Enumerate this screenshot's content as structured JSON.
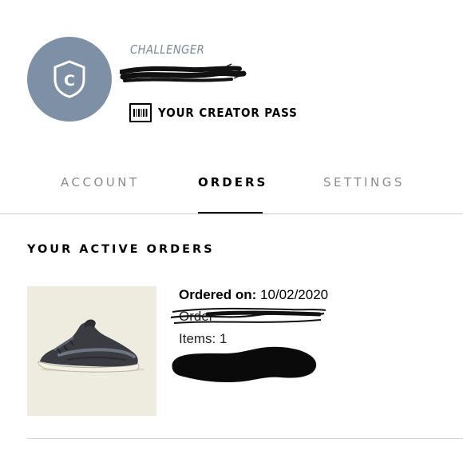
{
  "profile": {
    "avatar_initial": "C",
    "tier_label": "CHALLENGER",
    "creator_pass_label": "YOUR CREATOR PASS",
    "avatar_color": "#7d90a6",
    "tier_color": "#7a8796"
  },
  "tabs": [
    {
      "label": "ACCOUNT",
      "active": false
    },
    {
      "label": "ORDERS",
      "active": true
    },
    {
      "label": "SETTINGS",
      "active": false
    }
  ],
  "section": {
    "title": "YOUR ACTIVE ORDERS"
  },
  "order": {
    "date_label": "Ordered on:",
    "date_value": "10/02/2020",
    "number_label": "Order",
    "items_label": "Items: 1",
    "thumbnail_icon": "sneaker-image"
  },
  "icons": {
    "avatar": "shield-icon",
    "pass": "barcode-icon"
  }
}
